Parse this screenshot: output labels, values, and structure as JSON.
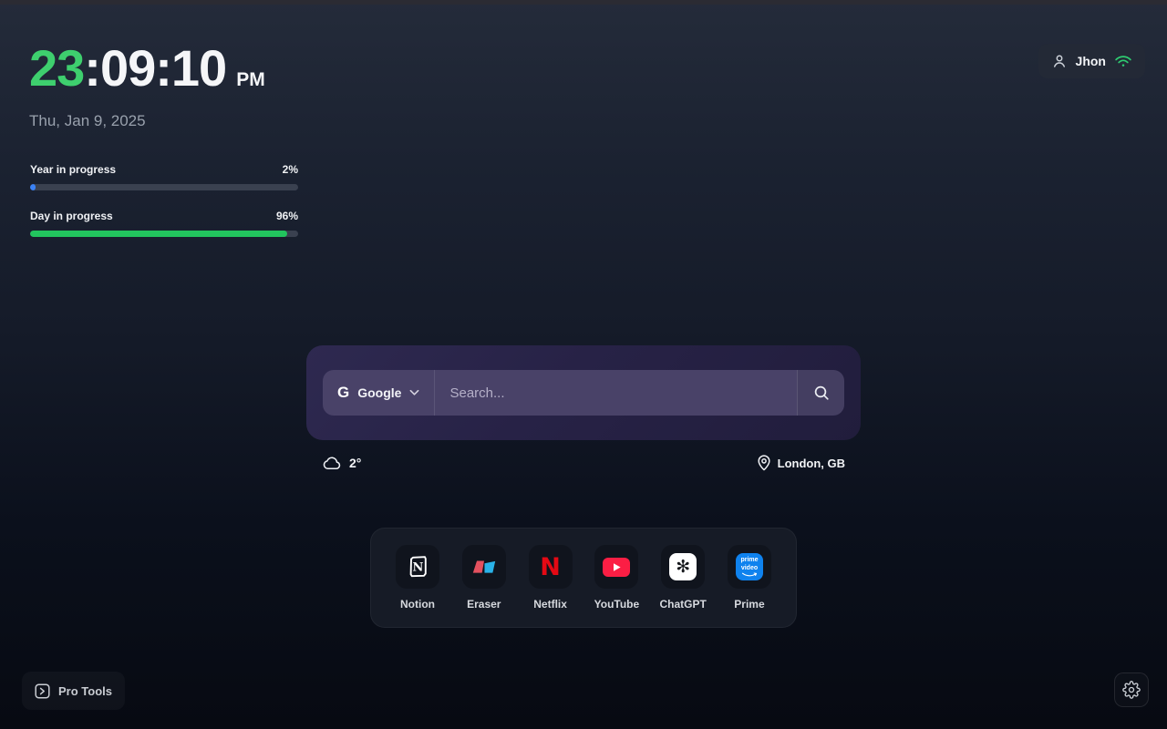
{
  "clock": {
    "hours": "23",
    "separator": ":",
    "minutes": "09",
    "seconds": "10",
    "meridiem": "PM",
    "date": "Thu, Jan 9, 2025"
  },
  "progress": [
    {
      "label": "Year in progress",
      "value": "2%",
      "percent": 2,
      "color": "#3b82f6"
    },
    {
      "label": "Day in progress",
      "value": "96%",
      "percent": 96,
      "color": "#22c55e"
    }
  ],
  "user": {
    "name": "Jhon"
  },
  "search": {
    "provider": "Google",
    "provider_initial": "G",
    "placeholder": "Search..."
  },
  "weather": {
    "temperature": "2°",
    "location": "London, GB"
  },
  "shortcuts": [
    {
      "label": "Notion"
    },
    {
      "label": "Eraser"
    },
    {
      "label": "Netflix"
    },
    {
      "label": "YouTube"
    },
    {
      "label": "ChatGPT"
    },
    {
      "label": "Prime"
    }
  ],
  "shortcut_glyphs": {
    "notion": "N",
    "netflix": "N",
    "chatgpt": "✻",
    "prime_line1": "prime",
    "prime_line2": "video"
  },
  "footer": {
    "pro_tools": "Pro Tools"
  },
  "colors": {
    "clock_accent": "#3ecf6e",
    "wifi": "#2ecc71",
    "year_fill": "#3b82f6",
    "day_fill": "#22c55e"
  }
}
